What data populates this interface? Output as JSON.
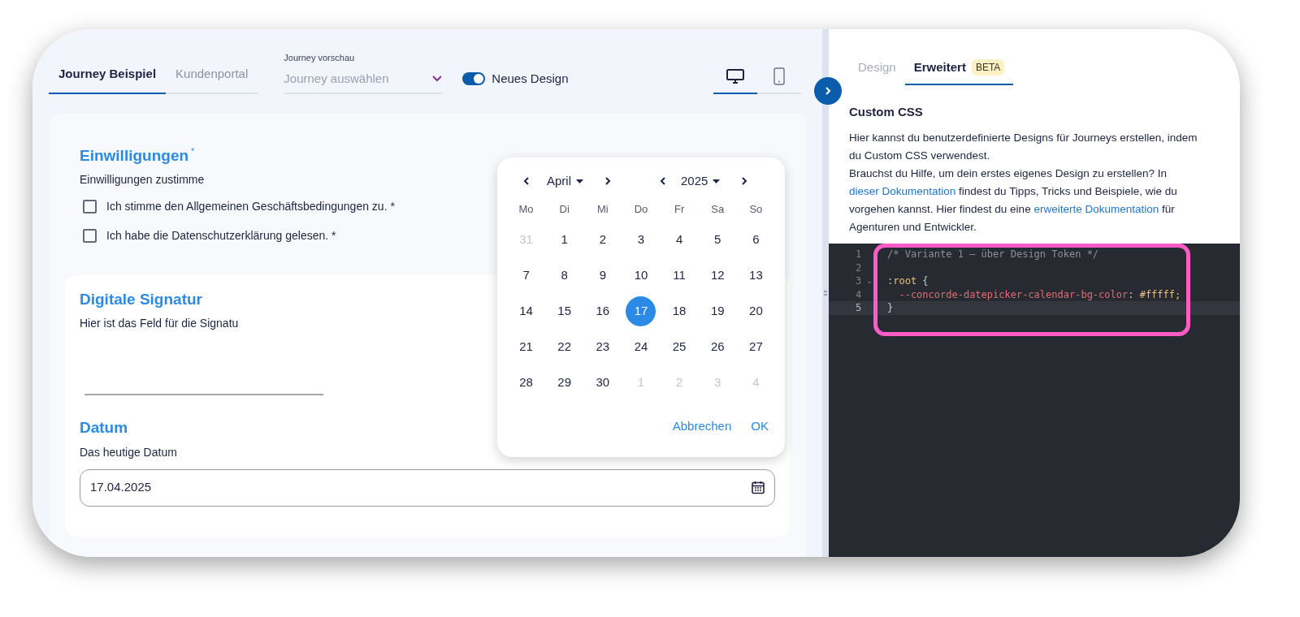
{
  "preview_tabs": [
    {
      "label": "Journey Beispiel",
      "selected": true
    },
    {
      "label": "Kundenportal",
      "selected": false
    }
  ],
  "journey_select": {
    "label": "Journey vorschau",
    "placeholder": "Journey auswählen"
  },
  "new_design_toggle": {
    "label": "Neues Design",
    "on": true
  },
  "device_tabs": [
    {
      "kind": "desktop",
      "selected": true
    },
    {
      "kind": "mobile",
      "selected": false
    }
  ],
  "form": {
    "consents": {
      "title": "Einwilligungen",
      "required_mark": "*",
      "description": "Einwilligungen zustimme",
      "checkboxes": [
        {
          "label": "Ich stimme den Allgemeinen Geschäftsbedingungen zu. *",
          "checked": false
        },
        {
          "label": "Ich habe die Datenschutzerklärung gelesen. *",
          "checked": false
        }
      ]
    },
    "signature": {
      "title": "Digitale Signatur",
      "description": "Hier ist das Feld für die Signatu"
    },
    "date": {
      "title": "Datum",
      "description": "Das heutige Datum",
      "value": "17.04.2025"
    }
  },
  "datepicker": {
    "month": "April",
    "year": "2025",
    "weekdays": [
      "Mo",
      "Di",
      "Mi",
      "Do",
      "Fr",
      "Sa",
      "So"
    ],
    "days": [
      {
        "label": "31",
        "outside": true,
        "selected": false
      },
      {
        "label": "1",
        "outside": false,
        "selected": false
      },
      {
        "label": "2",
        "outside": false,
        "selected": false
      },
      {
        "label": "3",
        "outside": false,
        "selected": false
      },
      {
        "label": "4",
        "outside": false,
        "selected": false
      },
      {
        "label": "5",
        "outside": false,
        "selected": false
      },
      {
        "label": "6",
        "outside": false,
        "selected": false
      },
      {
        "label": "7",
        "outside": false,
        "selected": false
      },
      {
        "label": "8",
        "outside": false,
        "selected": false
      },
      {
        "label": "9",
        "outside": false,
        "selected": false
      },
      {
        "label": "10",
        "outside": false,
        "selected": false
      },
      {
        "label": "11",
        "outside": false,
        "selected": false
      },
      {
        "label": "12",
        "outside": false,
        "selected": false
      },
      {
        "label": "13",
        "outside": false,
        "selected": false
      },
      {
        "label": "14",
        "outside": false,
        "selected": false
      },
      {
        "label": "15",
        "outside": false,
        "selected": false
      },
      {
        "label": "16",
        "outside": false,
        "selected": false
      },
      {
        "label": "17",
        "outside": false,
        "selected": true
      },
      {
        "label": "18",
        "outside": false,
        "selected": false
      },
      {
        "label": "19",
        "outside": false,
        "selected": false
      },
      {
        "label": "20",
        "outside": false,
        "selected": false
      },
      {
        "label": "21",
        "outside": false,
        "selected": false
      },
      {
        "label": "22",
        "outside": false,
        "selected": false
      },
      {
        "label": "23",
        "outside": false,
        "selected": false
      },
      {
        "label": "24",
        "outside": false,
        "selected": false
      },
      {
        "label": "25",
        "outside": false,
        "selected": false
      },
      {
        "label": "26",
        "outside": false,
        "selected": false
      },
      {
        "label": "27",
        "outside": false,
        "selected": false
      },
      {
        "label": "28",
        "outside": false,
        "selected": false
      },
      {
        "label": "29",
        "outside": false,
        "selected": false
      },
      {
        "label": "30",
        "outside": false,
        "selected": false
      },
      {
        "label": "1",
        "outside": true,
        "selected": false
      },
      {
        "label": "2",
        "outside": true,
        "selected": false
      },
      {
        "label": "3",
        "outside": true,
        "selected": false
      },
      {
        "label": "4",
        "outside": true,
        "selected": false
      }
    ],
    "buttons": [
      "Abbrechen",
      "OK"
    ]
  },
  "settings_tabs": [
    {
      "label": "Design",
      "selected": false
    },
    {
      "label": "Erweitert",
      "badge": "BETA",
      "selected": true
    }
  ],
  "custom_css": {
    "title": "Custom CSS",
    "paragraphs": [
      [
        {
          "kind": "text",
          "text": "Hier kannst du benutzerdefinierte Designs für Journeys erstellen, indem du Custom CSS verwendest."
        }
      ],
      [
        {
          "kind": "text",
          "text": "Brauchst du Hilfe, um dein erstes eigenes Design zu erstellen? In "
        },
        {
          "kind": "link",
          "text": "dieser Dokumentation"
        },
        {
          "kind": "text",
          "text": " findest du Tipps, Tricks und Beispiele, wie du vorgehen kannst. Hier findest du eine "
        },
        {
          "kind": "link",
          "text": "erweiterte Dokumentation"
        },
        {
          "kind": "text",
          "text": " für Agenturen und Entwickler."
        }
      ]
    ]
  },
  "editor": {
    "lines": [
      {
        "number": "1",
        "active": false,
        "tokens": [
          {
            "kind": "comment",
            "text": "/* Variante 1 – über Design Token */"
          }
        ]
      },
      {
        "number": "2",
        "active": false
      },
      {
        "number": "3",
        "fold_marker": "⌄",
        "active": false,
        "tokens": [
          {
            "kind": "punct",
            "text": ":"
          },
          {
            "kind": "selector",
            "text": "root"
          },
          {
            "kind": "punct",
            "text": " {"
          }
        ]
      },
      {
        "number": "4",
        "active": false,
        "tokens": [
          {
            "kind": "property",
            "text": "  --concorde-datepicker-calendar-bg-color"
          },
          {
            "kind": "punct",
            "text": ": "
          },
          {
            "kind": "value",
            "text": "#fffff;"
          }
        ]
      },
      {
        "number": "5",
        "active": true,
        "tokens": [
          {
            "kind": "punct",
            "text": "}"
          }
        ]
      }
    ]
  }
}
